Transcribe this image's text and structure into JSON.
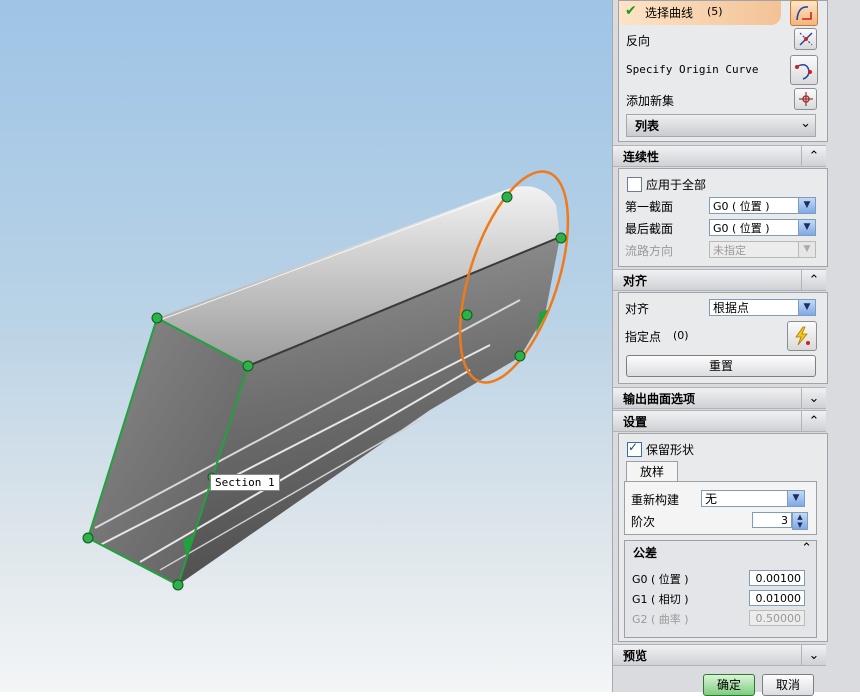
{
  "viewport": {
    "section_label": "Section  1"
  },
  "panel": {
    "select_curve": {
      "label": "选择曲线",
      "count": "(5)"
    },
    "reverse_label": "反向",
    "origin_curve_label": "Specify Origin Curve",
    "add_set_label": "添加新集",
    "list_label": "列表",
    "continuity": {
      "title": "连续性",
      "apply_all_label": "应用于全部",
      "first_section_label": "第一截面",
      "first_section_value": "G0 ( 位置 )",
      "last_section_label": "最后截面",
      "last_section_value": "G0 ( 位置 )",
      "flow_direction_label": "流路方向",
      "flow_direction_value": "未指定"
    },
    "alignment": {
      "title": "对齐",
      "align_label": "对齐",
      "align_value": "根据点",
      "specify_point_label": "指定点",
      "specify_point_count": "(0)",
      "reset_label": "重置"
    },
    "output_surface_title": "输出曲面选项",
    "settings": {
      "title": "设置",
      "preserve_shape_label": "保留形状",
      "tab_label": "放样",
      "rebuild_label": "重新构建",
      "rebuild_value": "无",
      "degree_label": "阶次",
      "degree_value": "3",
      "tolerance": {
        "title": "公差",
        "g0_label": "G0 ( 位置 )",
        "g0_value": "0.00100",
        "g1_label": "G1 ( 相切 )",
        "g1_value": "0.01000",
        "g2_label": "G2 ( 曲率 )",
        "g2_value": "0.50000"
      }
    },
    "preview_title": "预览",
    "ok_label": "确定",
    "cancel_label": "取消"
  },
  "colors": {
    "section_curve": "#1fa33a",
    "circle_curve": "#f07a1a",
    "point": "#2fb04a"
  }
}
